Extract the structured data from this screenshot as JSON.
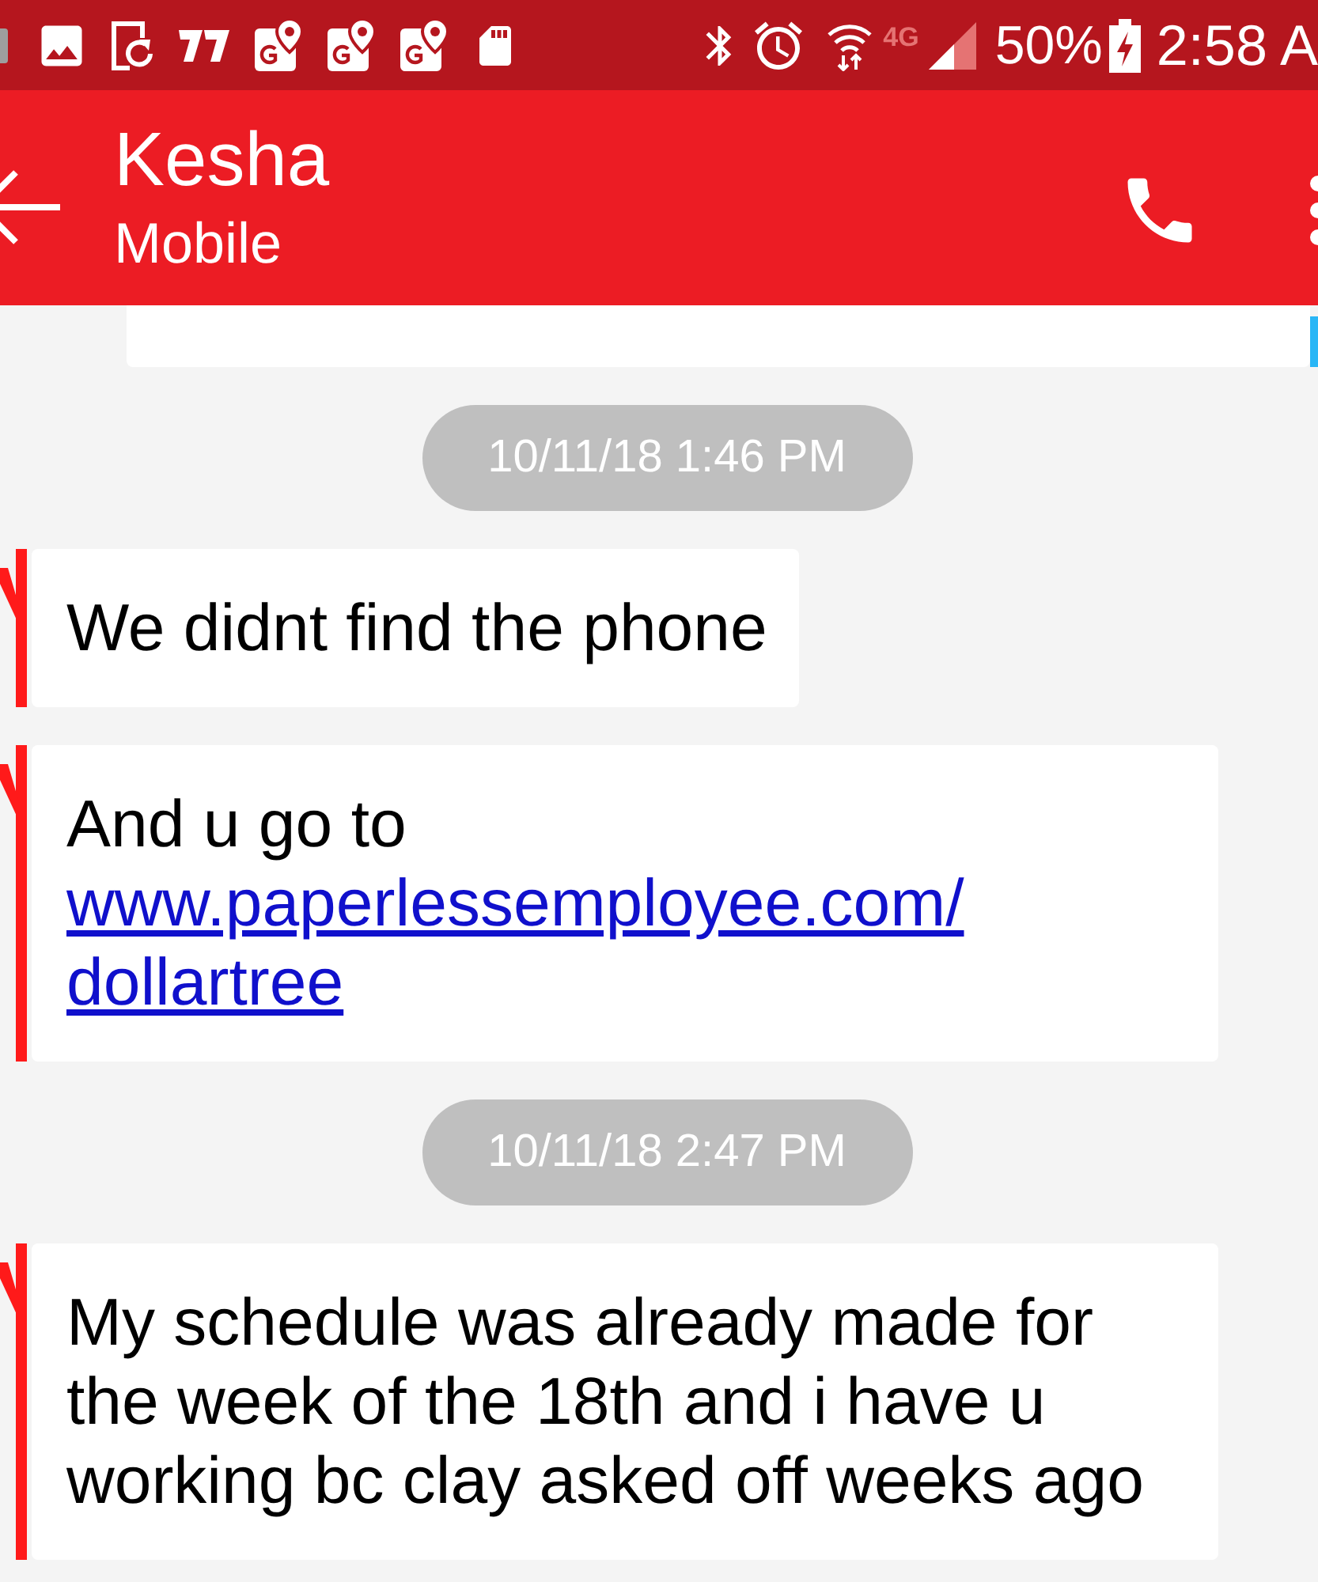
{
  "status_bar": {
    "network": "4G",
    "battery": "50%",
    "time": "2:58 A"
  },
  "header": {
    "title": "Kesha",
    "subtitle": "Mobile"
  },
  "conversation": [
    {
      "kind": "sent"
    },
    {
      "kind": "timestamp",
      "text": "10/11/18 1:46 PM"
    },
    {
      "kind": "received",
      "text": "We didnt find the phone"
    },
    {
      "kind": "received",
      "text": "And u go to",
      "link": "www.paperlessemployee.com/dollartree"
    },
    {
      "kind": "timestamp",
      "text": "10/11/18 2:47 PM"
    },
    {
      "kind": "received",
      "text": "My schedule was already made for the week of the 18th and i have u working bc clay asked off weeks ago"
    }
  ]
}
